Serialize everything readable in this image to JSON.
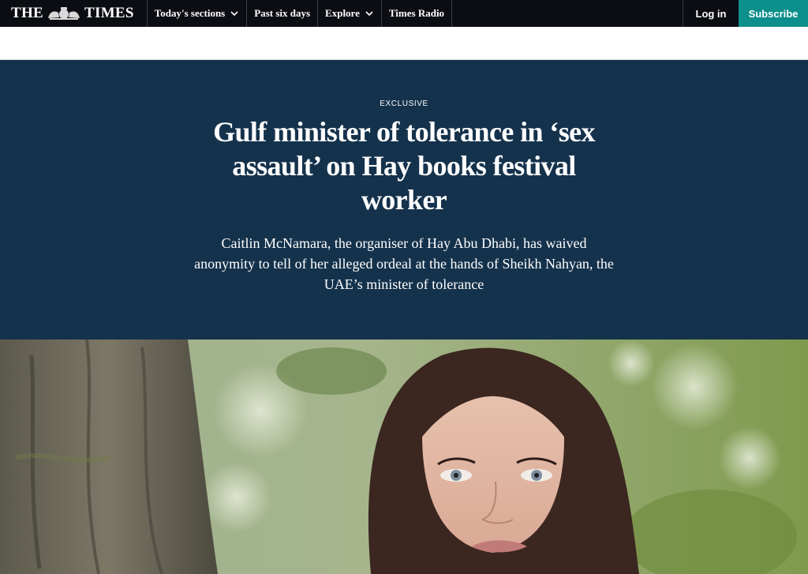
{
  "nav": {
    "logo_left": "THE",
    "logo_right": "TIMES",
    "logo_crest_icon": "royal-crest-icon",
    "items": [
      {
        "label": "Today's sections",
        "has_dropdown": true
      },
      {
        "label": "Past six days",
        "has_dropdown": false
      },
      {
        "label": "Explore",
        "has_dropdown": true
      },
      {
        "label": "Times Radio",
        "has_dropdown": false
      }
    ],
    "login_label": "Log in",
    "subscribe_label": "Subscribe"
  },
  "article": {
    "kicker": "EXCLUSIVE",
    "headline": "Gulf minister of tolerance in ‘sex assault’ on Hay books festival worker",
    "standfirst": "Caitlin McNamara, the organiser of Hay Abu Dhabi, has waived anonymity to tell of her alleged ordeal at the hands of Sheikh Nahyan, the UAE’s minister of tolerance"
  },
  "colors": {
    "nav_bg": "#0b0d12",
    "hero_bg": "#15324c",
    "subscribe_bg": "#0d8f8b"
  }
}
